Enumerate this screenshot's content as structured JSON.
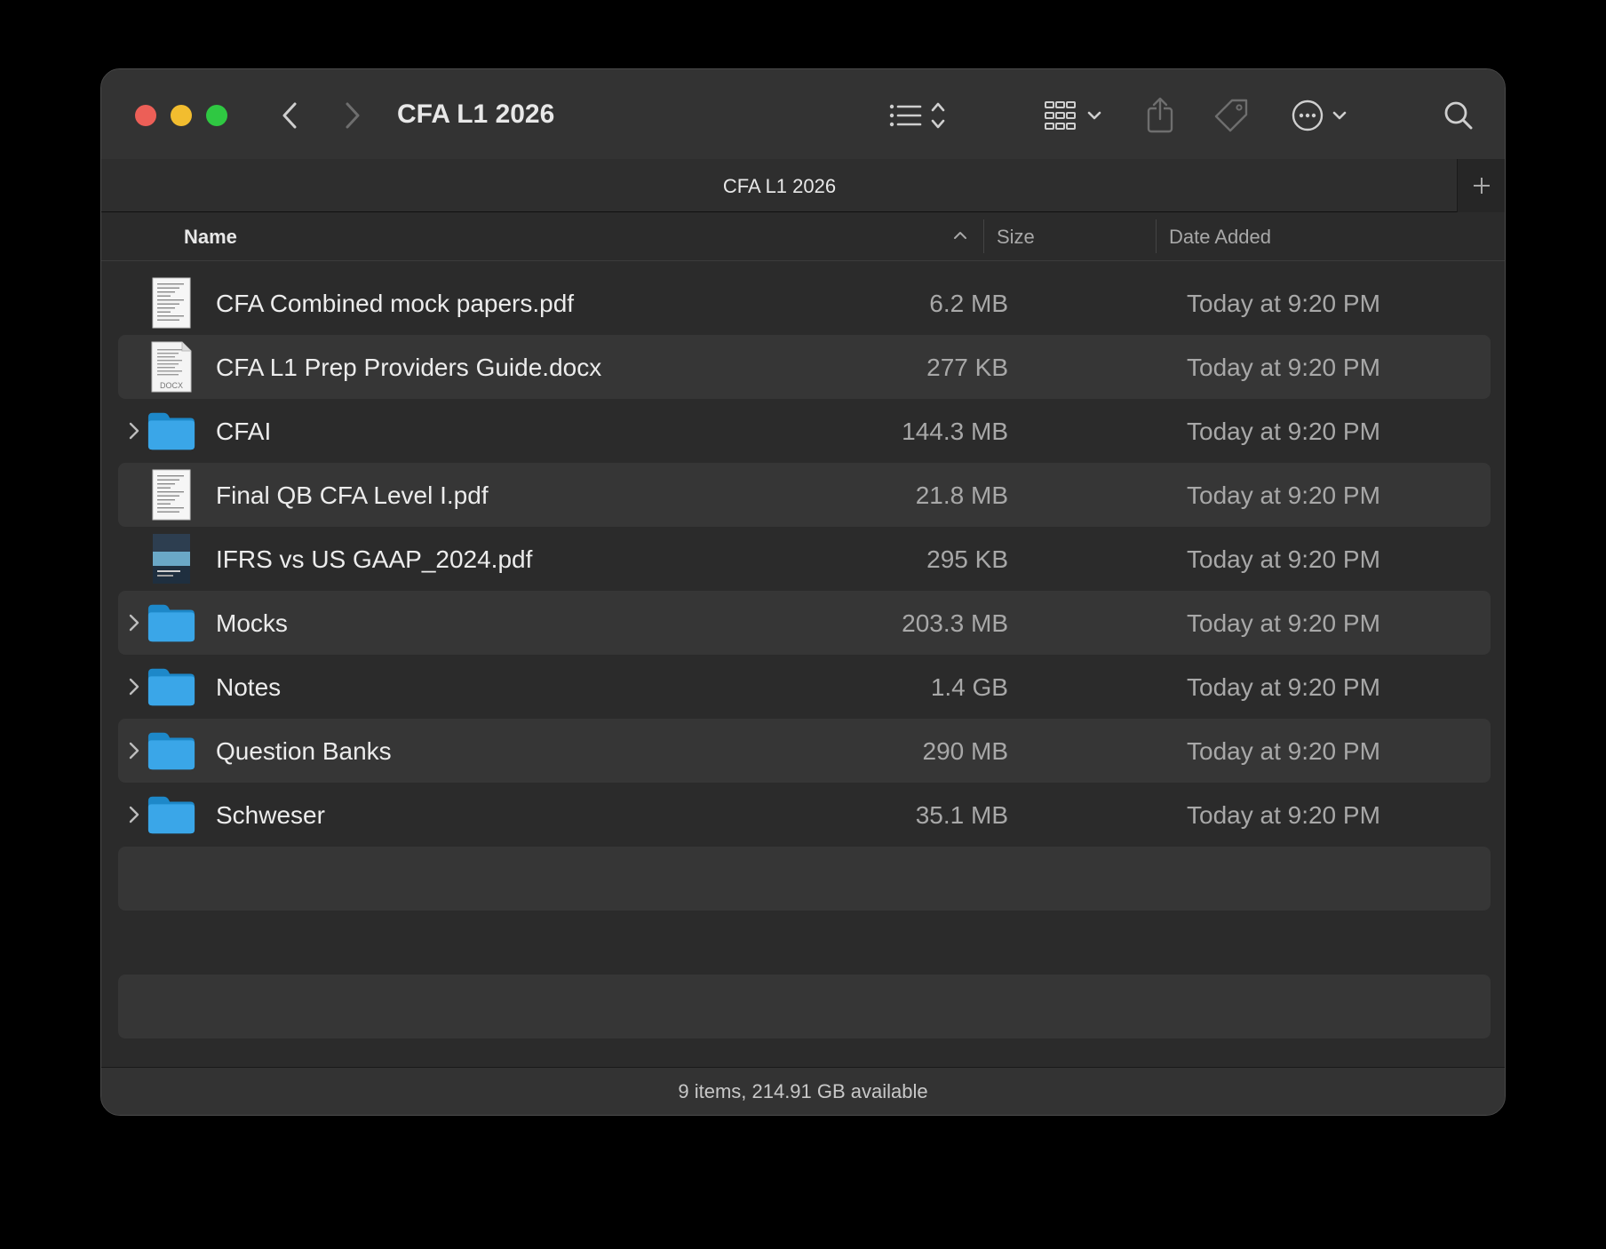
{
  "window": {
    "title": "CFA L1 2026",
    "tab_title": "CFA L1 2026",
    "toolbar_icons": [
      "back-icon",
      "forward-icon",
      "list-view-icon",
      "group-icon",
      "share-icon",
      "tag-icon",
      "more-icon",
      "search-icon"
    ]
  },
  "columns": {
    "name": "Name",
    "size": "Size",
    "date_added": "Date Added",
    "sort": "ascending-by-name"
  },
  "files": [
    {
      "name": "CFA Combined mock papers.pdf",
      "size": "6.2 MB",
      "date": "Today at 9:20 PM",
      "kind": "pdf"
    },
    {
      "name": "CFA L1 Prep Providers Guide.docx",
      "size": "277 KB",
      "date": "Today at 9:20 PM",
      "kind": "docx"
    },
    {
      "name": "CFAI",
      "size": "144.3 MB",
      "date": "Today at 9:20 PM",
      "kind": "folder"
    },
    {
      "name": "Final QB CFA Level I.pdf",
      "size": "21.8 MB",
      "date": "Today at 9:20 PM",
      "kind": "pdf"
    },
    {
      "name": "IFRS vs US GAAP_2024.pdf",
      "size": "295 KB",
      "date": "Today at 9:20 PM",
      "kind": "pdf-cover"
    },
    {
      "name": "Mocks",
      "size": "203.3 MB",
      "date": "Today at 9:20 PM",
      "kind": "folder"
    },
    {
      "name": "Notes",
      "size": "1.4 GB",
      "date": "Today at 9:20 PM",
      "kind": "folder"
    },
    {
      "name": "Question Banks",
      "size": "290 MB",
      "date": "Today at 9:20 PM",
      "kind": "folder"
    },
    {
      "name": "Schweser",
      "size": "35.1 MB",
      "date": "Today at 9:20 PM",
      "kind": "folder"
    }
  ],
  "status": {
    "text": "9 items, 214.91 GB available"
  },
  "colors": {
    "close": "#ec5f57",
    "minimize": "#f2bd2f",
    "maximize": "#2fc842",
    "folder": "#3aa6e8"
  }
}
